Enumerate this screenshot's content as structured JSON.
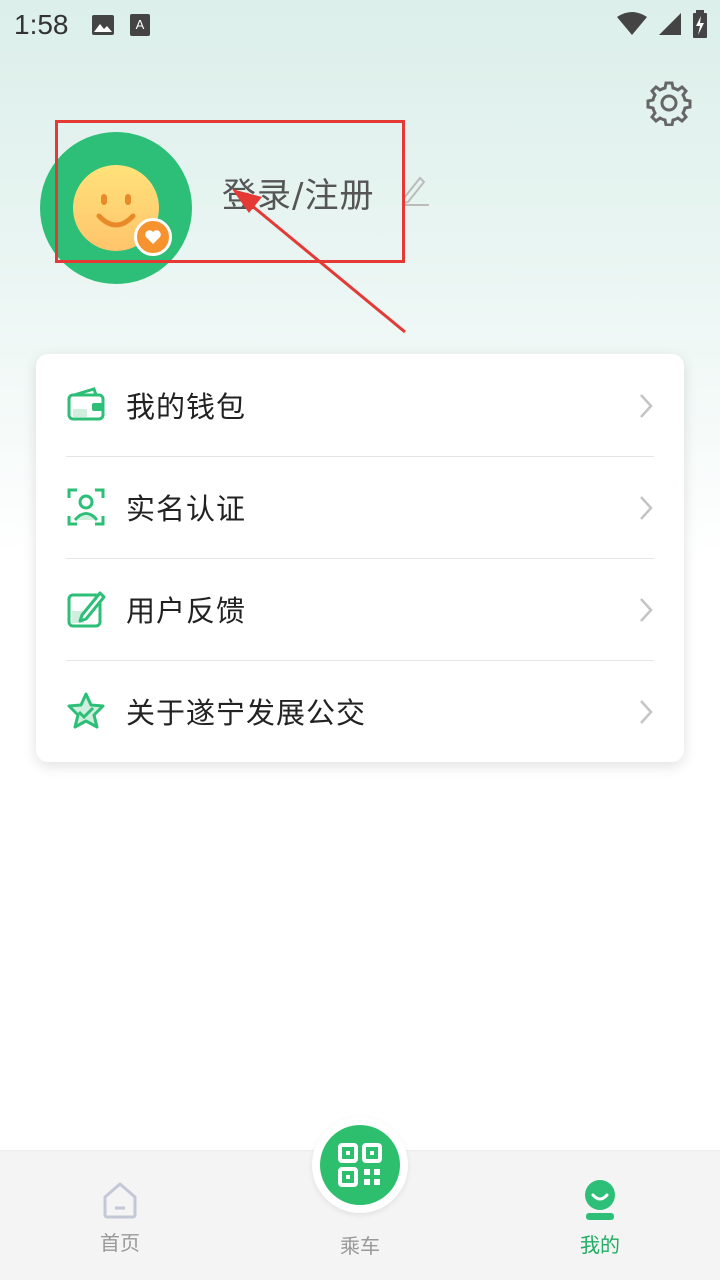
{
  "status_bar": {
    "time": "1:58"
  },
  "profile": {
    "login_label": "登录/注册"
  },
  "menu": {
    "items": [
      {
        "label": "我的钱包",
        "icon": "wallet-icon"
      },
      {
        "label": "实名认证",
        "icon": "face-id-icon"
      },
      {
        "label": "用户反馈",
        "icon": "feedback-edit-icon"
      },
      {
        "label": "关于遂宁发展公交",
        "icon": "star-check-icon"
      }
    ]
  },
  "bottom_nav": {
    "home_label": "首页",
    "ride_label": "乘车",
    "mine_label": "我的",
    "active": "我的"
  },
  "colors": {
    "brand_green": "#2dbf77",
    "badge_orange": "#f7932e",
    "annotation_red": "#e53935"
  }
}
